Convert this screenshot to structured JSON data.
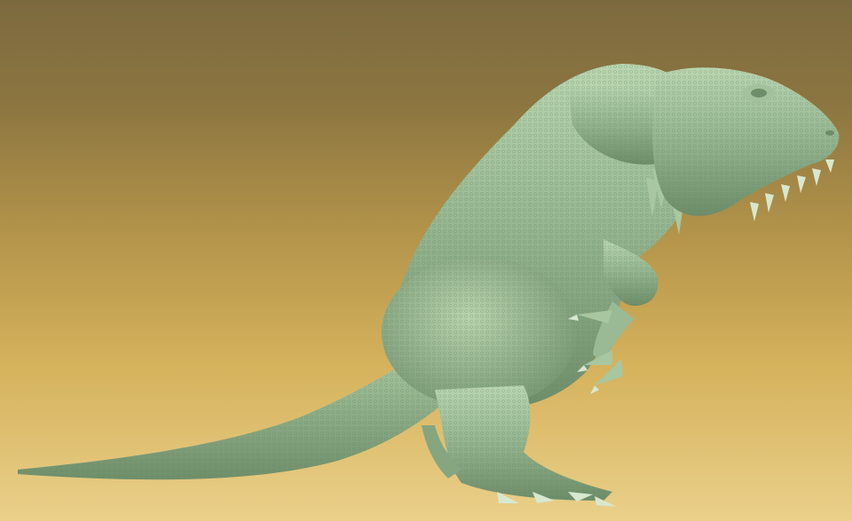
{
  "scene": {
    "subject": "creature",
    "colors": {
      "background_top": "#7c6a3f",
      "background_mid": "#b3944a",
      "background_bottom": "#ead08a",
      "skin_base": "#93b48f",
      "skin_highlight": "#c0dcb6",
      "skin_shadow": "#5e7d5c",
      "claw": "#d7e8cf"
    }
  }
}
